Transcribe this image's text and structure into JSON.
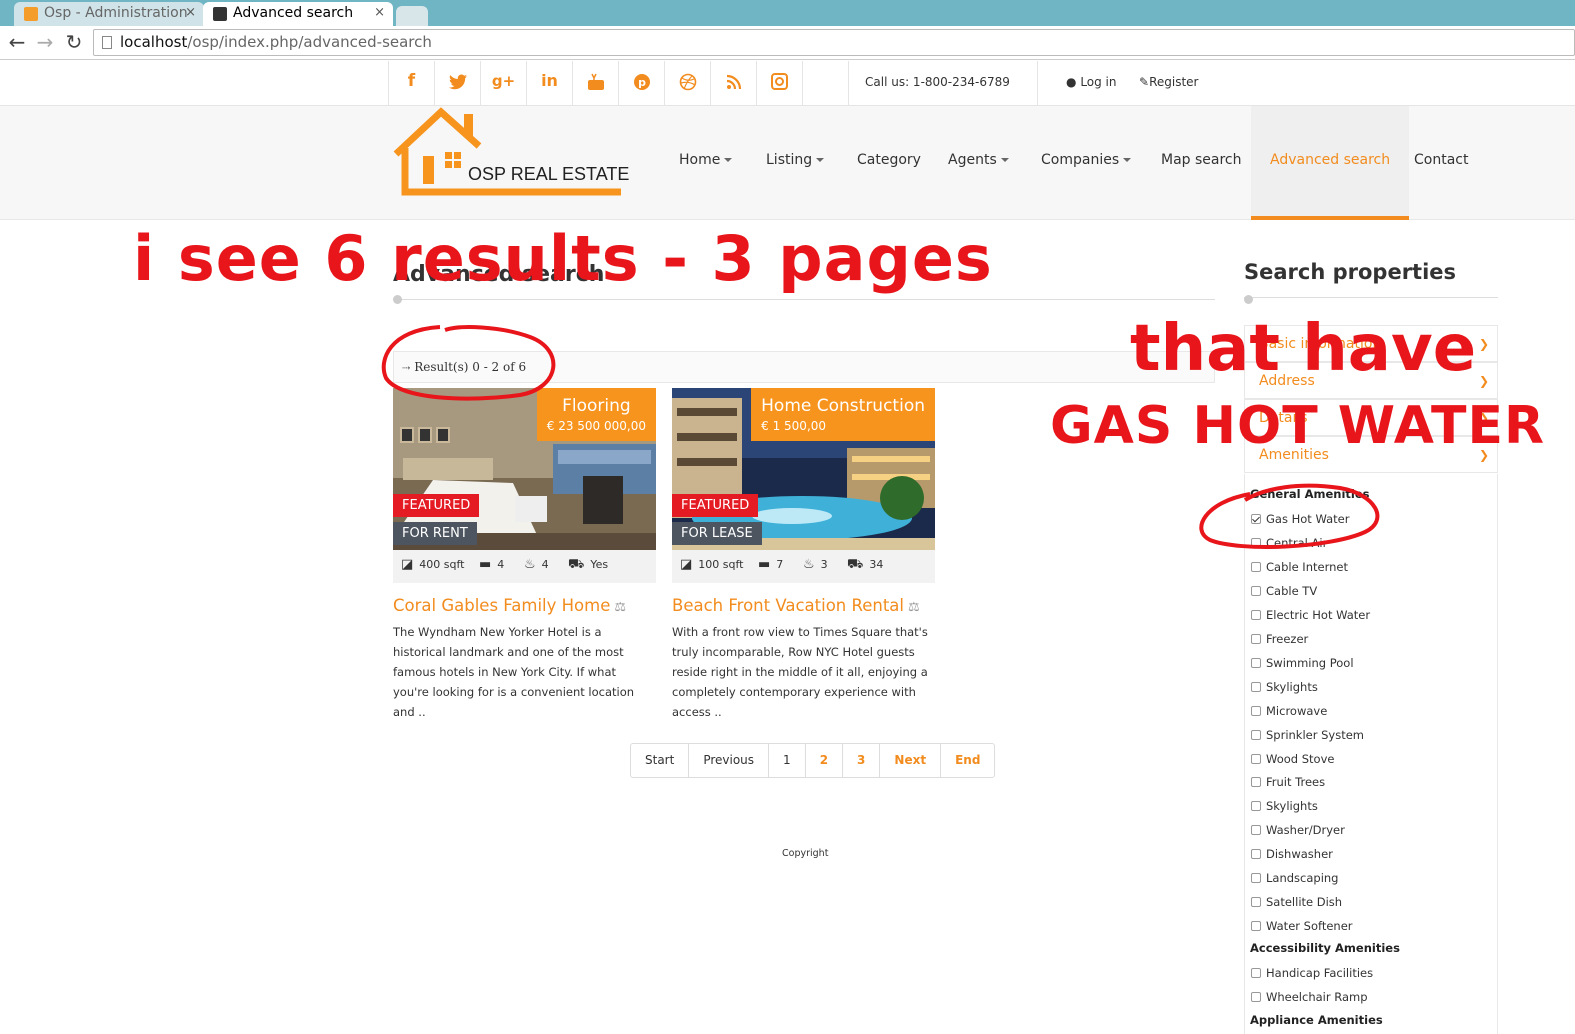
{
  "browser": {
    "tabs": [
      {
        "title": "Osp - Administration",
        "active": false
      },
      {
        "title": "Advanced search",
        "active": true
      }
    ],
    "url_host": "localhost",
    "url_path": "/osp/index.php/advanced-search"
  },
  "topbar": {
    "social": [
      "facebook-icon",
      "twitter-icon",
      "google-plus-icon",
      "linkedin-icon",
      "youtube-icon",
      "pinterest-icon",
      "dribbble-icon",
      "rss-icon",
      "instagram-icon"
    ],
    "call": "Call us: 1-800-234-6789",
    "login": "Log in",
    "register": "Register"
  },
  "header": {
    "logo_text": "OSP REAL ESTATE",
    "menu": [
      {
        "label": "Home",
        "dropdown": true
      },
      {
        "label": "Listing",
        "dropdown": true
      },
      {
        "label": "Category",
        "dropdown": false
      },
      {
        "label": "Agents",
        "dropdown": true
      },
      {
        "label": "Companies",
        "dropdown": true
      },
      {
        "label": "Map search",
        "dropdown": false
      },
      {
        "label": "Advanced search",
        "dropdown": false,
        "active": true
      },
      {
        "label": "Contact",
        "dropdown": false
      }
    ]
  },
  "main": {
    "title": "Advanced search",
    "result_text": "Result(s) 0 - 2 of 6",
    "cards": [
      {
        "type": "Flooring",
        "price": "€ 23 500 000,00",
        "featured": "FEATURED",
        "status": "FOR RENT",
        "sqft": "400 sqft",
        "beds": "4",
        "baths": "4",
        "parking": "Yes",
        "title": "Coral Gables Family Home",
        "desc": "The Wyndham New Yorker Hotel is a historical landmark and one of the most famous hotels in New York City. If what you're looking for is a convenient location and .."
      },
      {
        "type": "Home Construction",
        "price": "€ 1 500,00",
        "featured": "FEATURED",
        "status": "FOR LEASE",
        "sqft": "100 sqft",
        "beds": "7",
        "baths": "3",
        "parking": "34",
        "title": "Beach Front Vacation Rental",
        "desc": "With a front row view to Times Square that's truly incomparable, Row NYC Hotel guests reside right in the middle of it all, enjoying a completely contemporary experience with access .."
      }
    ],
    "pagination": [
      "Start",
      "Previous",
      "1",
      "2",
      "3",
      "Next",
      "End"
    ],
    "copyright": "Copyright"
  },
  "sidebar": {
    "title": "Search properties",
    "sections": [
      "Basic information",
      "Address",
      "Details",
      "Amenities"
    ],
    "groups": [
      {
        "title": "General Amenities"
      },
      {
        "title": "Accessibility Amenities"
      },
      {
        "title": "Appliance Amenities"
      }
    ],
    "general": [
      "Gas Hot Water",
      "Central Air",
      "Cable Internet",
      "Cable TV",
      "Electric Hot Water",
      "Freezer",
      "Swimming Pool",
      "Skylights",
      "Microwave",
      "Sprinkler System",
      "Wood Stove",
      "Fruit Trees",
      "Skylights",
      "Washer/Dryer",
      "Dishwasher",
      "Landscaping",
      "Satellite Dish",
      "Water Softener"
    ],
    "accessibility": [
      "Handicap Facilities",
      "Wheelchair Ramp"
    ]
  },
  "annotations": {
    "a1": "i see 6 results - 3 pages",
    "a2": "that have",
    "a3": "GAS HOT WATER"
  },
  "colors": {
    "accent": "#f28c1e",
    "featured": "#e51b24",
    "annotation": "#e8151b"
  }
}
